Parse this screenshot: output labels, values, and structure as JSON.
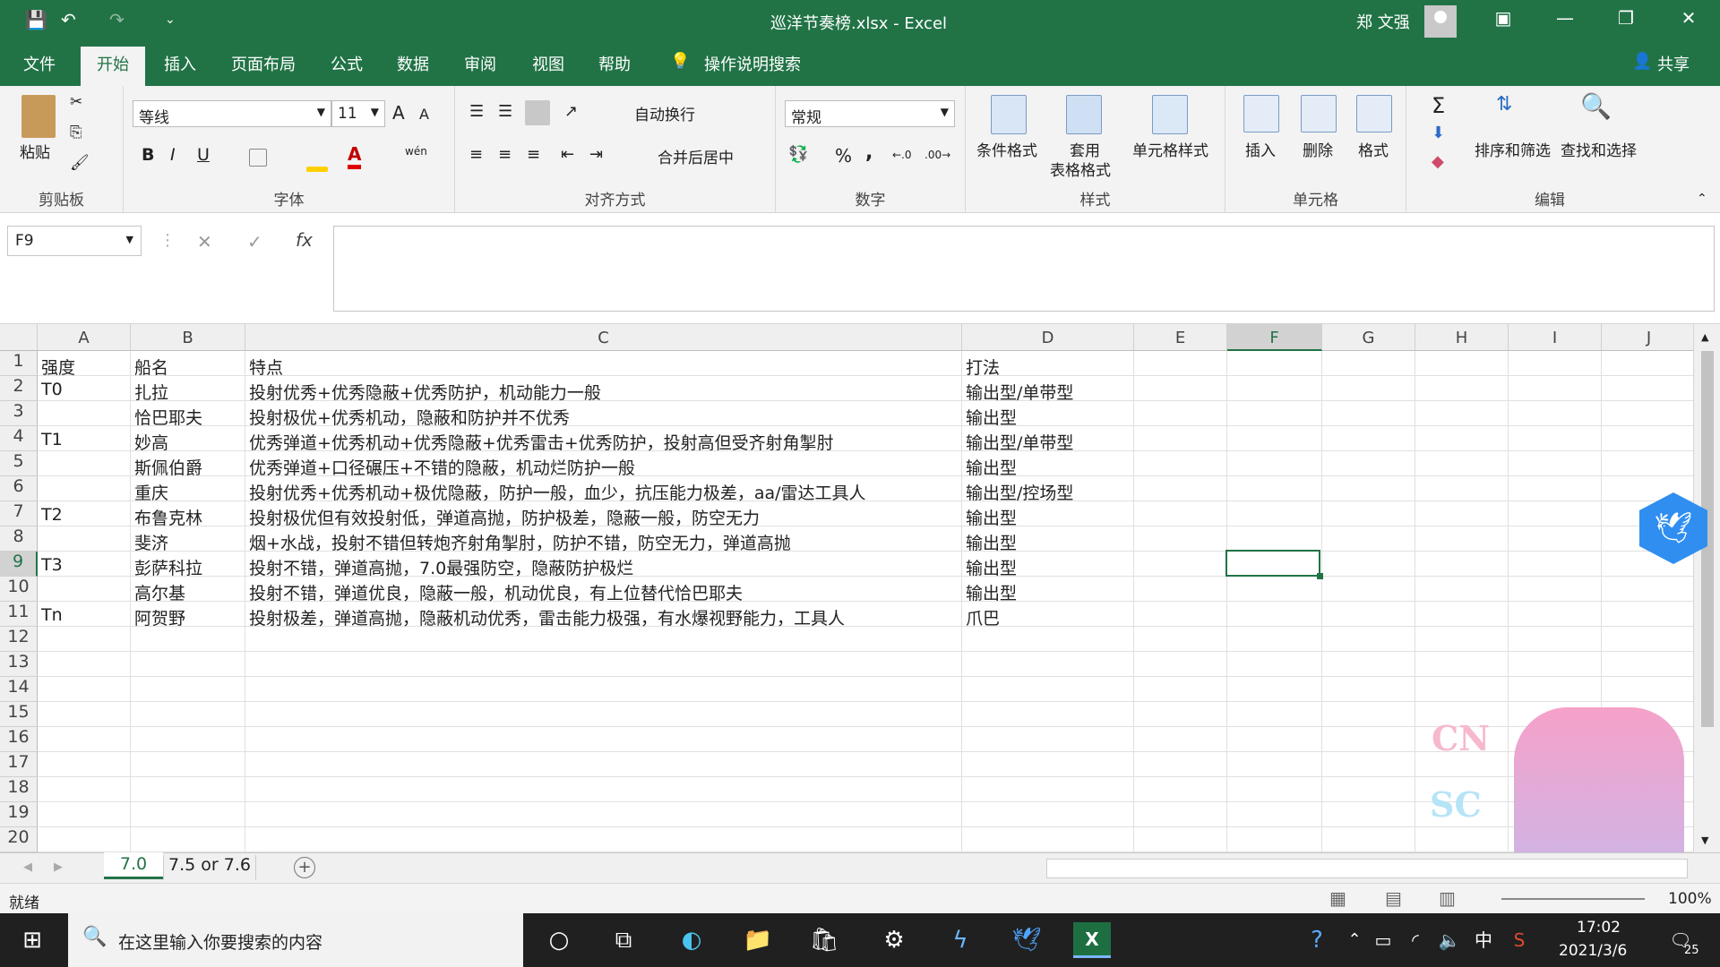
{
  "window": {
    "title": "巡洋节奏榜.xlsx  -  Excel",
    "user": "郑 文强"
  },
  "qat": {
    "save": "💾",
    "undo": "↶",
    "redo": "↷",
    "more": "⌄"
  },
  "window_controls": {
    "ribbon_display": "▣",
    "minimize": "—",
    "restore": "❐",
    "close": "✕"
  },
  "tabs": [
    "文件",
    "开始",
    "插入",
    "页面布局",
    "公式",
    "数据",
    "审阅",
    "视图",
    "帮助"
  ],
  "tell_me": "操作说明搜索",
  "share": "共享",
  "ribbon": {
    "clipboard": {
      "label": "剪贴板",
      "paste": "粘贴"
    },
    "font": {
      "label": "字体",
      "name": "等线",
      "size": "11",
      "bold": "B",
      "italic": "I",
      "underline": "U",
      "grow": "A",
      "shrink": "A",
      "phonetic": "wén"
    },
    "alignment": {
      "label": "对齐方式",
      "wrap": "自动换行",
      "merge": "合并后居中"
    },
    "number": {
      "label": "数字",
      "format": "常规",
      "percent": "%",
      "comma": ","
    },
    "styles": {
      "label": "样式",
      "conditional": "条件格式",
      "as_table_1": "套用",
      "as_table_2": "表格格式",
      "cell_styles": "单元格样式"
    },
    "cells": {
      "label": "单元格",
      "insert": "插入",
      "delete": "删除",
      "format": "格式"
    },
    "editing": {
      "label": "编辑",
      "sort": "排序和筛选",
      "find": "查找和选择",
      "sum": "Σ"
    }
  },
  "formula_bar": {
    "name_box": "F9",
    "cancel": "✕",
    "enter": "✓",
    "fx": "fx",
    "content": ""
  },
  "columns": [
    {
      "name": "A"
    },
    {
      "name": "B"
    },
    {
      "name": "C"
    },
    {
      "name": "D"
    },
    {
      "name": "E"
    },
    {
      "name": "F"
    },
    {
      "name": "G"
    },
    {
      "name": "H"
    },
    {
      "name": "I"
    },
    {
      "name": "J"
    }
  ],
  "rows": [
    "1",
    "2",
    "3",
    "4",
    "5",
    "6",
    "7",
    "8",
    "9",
    "10",
    "11",
    "12",
    "13",
    "14",
    "15",
    "16",
    "17",
    "18",
    "19",
    "20"
  ],
  "table": [
    [
      "强度",
      "船名",
      "特点",
      "打法"
    ],
    [
      "T0",
      "扎拉",
      "投射优秀+优秀隐蔽+优秀防护，机动能力一般",
      "输出型/单带型"
    ],
    [
      "",
      "恰巴耶夫",
      "投射极优+优秀机动，隐蔽和防护并不优秀",
      "输出型"
    ],
    [
      "T1",
      "妙高",
      "优秀弹道+优秀机动+优秀隐蔽+优秀雷击+优秀防护，投射高但受齐射角掣肘",
      "输出型/单带型"
    ],
    [
      "",
      "斯佩伯爵",
      "优秀弹道+口径碾压+不错的隐蔽，机动烂防护一般",
      "输出型"
    ],
    [
      "",
      "重庆",
      "投射优秀+优秀机动+极优隐蔽，防护一般，血少，抗压能力极差，aa/雷达工具人",
      "输出型/控场型"
    ],
    [
      "T2",
      "布鲁克林",
      "投射极优但有效投射低，弹道高抛，防护极差，隐蔽一般，防空无力",
      "输出型"
    ],
    [
      "",
      "斐济",
      "烟+水战，投射不错但转炮齐射角掣肘，防护不错，防空无力，弹道高抛",
      "输出型"
    ],
    [
      "T3",
      "彭萨科拉",
      "投射不错，弹道高抛，7.0最强防空，隐蔽防护极烂",
      "输出型"
    ],
    [
      "",
      "高尔基",
      "投射不错，弹道优良，隐蔽一般，机动优良，有上位替代恰巴耶夫",
      "输出型"
    ],
    [
      "Tn",
      "阿贺野",
      "投射极差，弹道高抛，隐蔽机动优秀，雷击能力极强，有水爆视野能力，工具人",
      "爪巴"
    ]
  ],
  "selected_cell": "F9",
  "sheet_tabs": [
    "7.0",
    "7.5 or 7.6"
  ],
  "status": {
    "text": "就绪",
    "zoom": "100%"
  },
  "overlay": {
    "cn": "CN",
    "sc": "SC"
  },
  "taskbar": {
    "search": "在这里输入你要搜索的内容",
    "time": "17:02",
    "date": "2021/3/6",
    "ime": "中",
    "notif": "25"
  },
  "colors": {
    "excel_green": "#217346",
    "selection": "#217346"
  }
}
